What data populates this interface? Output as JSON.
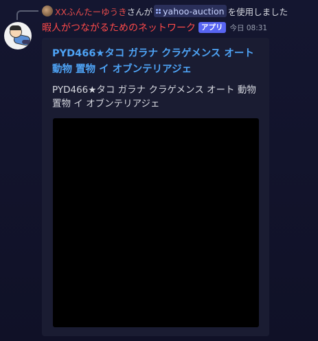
{
  "reply": {
    "author": "XXふんたーゆうき",
    "text_before": "さんが",
    "command": "yahoo-auction",
    "text_after": "を使用しました"
  },
  "message": {
    "author": "暇人がつながるためのネットワーク",
    "badge": "アプリ",
    "timestamp": "今日 08:31"
  },
  "embed": {
    "title": "PYD466★タコ ガラナ クラゲメンス オート 動物 置物 イ オブンテリアジェ",
    "description": "PYD466★タコ ガラナ クラゲメンス オート 動物 置物 イ オブンテリアジェ"
  },
  "colors": {
    "username": "#ff4a4a",
    "reply_author": "#e74c4c",
    "badge": "#5865f2",
    "embed_title": "#4ea3f5"
  }
}
